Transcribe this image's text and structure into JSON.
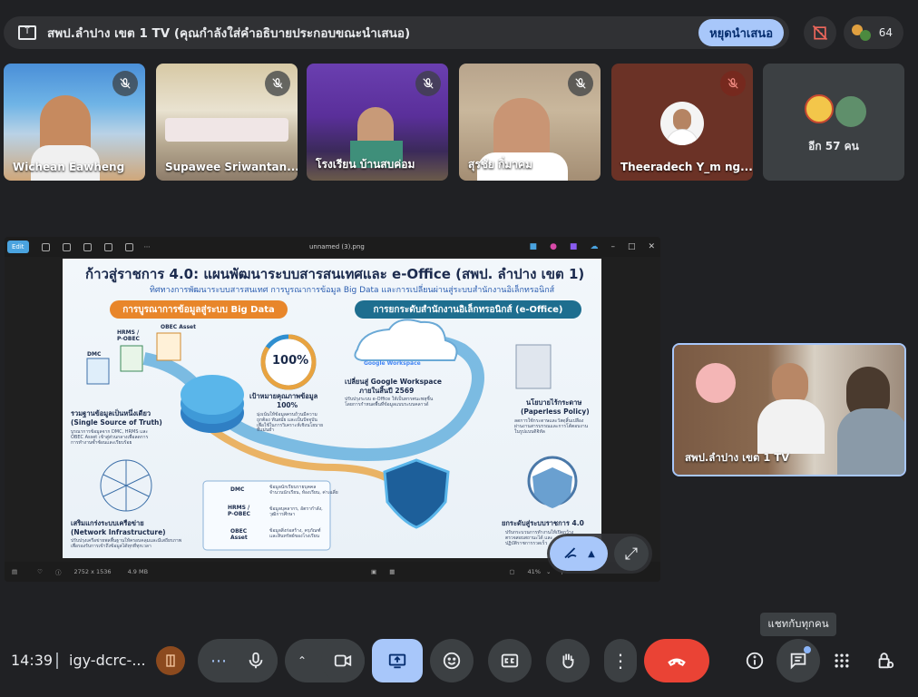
{
  "top_bar": {
    "title": "สพป.ลำปาง เขต 1 TV (คุณกำลังใส่คำอธิบายประกอบขณะนำเสนอ)",
    "stop_label": "หยุดนำเสนอ",
    "people_count": "64"
  },
  "participants": [
    {
      "name": "Wichean Eawheng",
      "muted": true
    },
    {
      "name": "Supawee Sriwantan...",
      "muted": true
    },
    {
      "name": "โรงเรียน บ้านสบค่อม",
      "muted": true
    },
    {
      "name": "สุรชัย กิ่มาคม",
      "muted": true
    },
    {
      "name": "Theeradech Y_m ng...",
      "muted": true,
      "highlighted": true
    }
  ],
  "more_tile": {
    "label": "อีก 57 คน"
  },
  "shared_window": {
    "edit_label": "Edit",
    "file_name": "unnamed (3).png",
    "status_dims": "2752 x 1536",
    "status_size": "4.9 MB",
    "zoom": "41%"
  },
  "slide": {
    "title": "ก้าวสู่ราชการ 4.0: แผนพัฒนาระบบสารสนเทศและ e-Office (สพป. ลำปาง เขต 1)",
    "subtitle": "ทิศทางการพัฒนาระบบสารสนเทศ การบูรณาการข้อมูล Big Data และการเปลี่ยนผ่านสู่ระบบสำนักงานอิเล็กทรอนิกส์",
    "left_header": "การบูรณาการข้อมูลสู่ระบบ Big Data",
    "right_header": "การยกระดับสำนักงานอิเล็กทรอนิกส์ (e-Office)",
    "left_labels": {
      "obec_asset": "OBEC Asset",
      "hrms": "HRMS /\nP-OBEC",
      "dmc": "DMC",
      "sst_1": "รวมฐานข้อมูลเป็นหนึ่งเดียว",
      "sst_2": "(Single Source of Truth)",
      "sst_desc": "บูรณาการข้อมูลจาก DMC, HRMS และ\nOBEC Asset เข้าสู่ส่วนกลางเพื่อลดการ\nการทำงานซ้ำซ้อนและเรียบร้อย",
      "net_1": "เสริมแกร่งระบบเครือข่าย",
      "net_2": "(Network Infrastructure)",
      "net_desc": "ปรับปรุงเครือข่ายพลพื้นฐานให้ครอบคลุมและมีเสถียรภาพ\nเพื่อรองรับการเข้าถึงข้อมูลได้ทุกที่ทุกเวลา",
      "pct": "100%",
      "quality_1": "เป้าหมายคุณภาพข้อมูล",
      "quality_2": "100%",
      "quality_desc": "มุ่งเน้นให้ข้อมูลครบถ้วนมีความ\nถูกต้อง ทันสมัย และเป็นปัจจุบัน\nเพื่อใช้ในการวิเคราะห์เชิงนโยบาย\nที่แม่นยำ"
    },
    "legend": [
      {
        "tag": "DMC",
        "desc": "ข้อมูลนักเรียนรายบุคคล\nจำนวนนักเรียน, ห้องเรียน, ค่าเฉลี่ย"
      },
      {
        "tag": "HRMS /\nP-OBEC",
        "desc": "ข้อมูลบุคลากร, อัตรากำลัง,\nวุฒิการศึกษา"
      },
      {
        "tag": "OBEC\nAsset",
        "desc": "ข้อมูลสิ่งก่อสร้าง, ครุภัณฑ์\nและสินทรัพย์ของโรงเรียน"
      }
    ],
    "right_labels": {
      "google": "Google Workspace",
      "gw_1": "เปลี่ยนสู่ Google Workspace",
      "gw_2": "ภายในสิ้นปี 2569",
      "gw_desc": "ปรับปรุงระบบ e-Office ให้เป็นทรรศนะพหุชิ้น\nโดยการกำหนดพื้นที่ข้อมูลแบบระบบคลาวด์",
      "paper_1": "นโยบายไร้กระดาษ",
      "paper_2": "(Paperless Policy)",
      "paper_desc": "ลดการใช้กระดาษและวัสดุสิ้นเปลือง\nผ่านงานสารบรรณและการโต้ตอบงาน\nในรูปแบบดิจิทัล",
      "gov_1": "ยกระดับสู่ระบบราชการ 4.0",
      "gov_desc": "ปรับกระบวนการทำงานให้เปิดกว้าง\nตรวจสอบสถานะได้ และ\nปฏิบัติราชการรวดเร็ว"
    }
  },
  "self_view": {
    "name": "สพป.ลำปาง เขต 1 TV"
  },
  "tooltip": "แชทกับทุกคน",
  "bottom": {
    "clock": "14:39",
    "meeting_code": "igy-dcrc-..."
  },
  "colors": {
    "background": "#202124",
    "accent": "#a8c7fa",
    "end_call": "#ea4335"
  }
}
